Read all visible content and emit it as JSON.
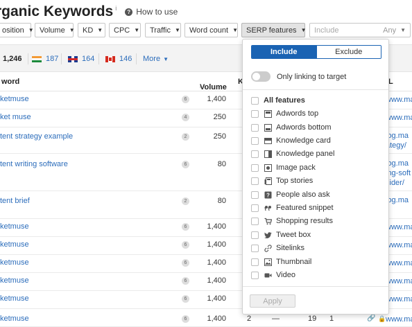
{
  "header": {
    "title": "rganic Keywords",
    "info": "i",
    "how_to": "How to use"
  },
  "filters": {
    "position": "osition",
    "volume": "Volume",
    "kd": "KD",
    "cpc": "CPC",
    "traffic": "Traffic",
    "word_count": "Word count",
    "serp_features": "SERP features",
    "include_placeholder": "Include",
    "any": "Any"
  },
  "stats": {
    "total": "1,246",
    "in": "187",
    "gb": "164",
    "ca": "146",
    "more": "More"
  },
  "table": {
    "col_keyword": "word",
    "col_volume": "Volume",
    "col_k": "K",
    "col_url": "L",
    "rows": [
      {
        "kw": "ketmuse",
        "badge": "6",
        "vol": "1,400",
        "url": "www.ma"
      },
      {
        "kw": "ket muse",
        "badge": "4",
        "vol": "250",
        "url": "www.ma"
      },
      {
        "kw": "tent strategy example",
        "badge": "2",
        "vol": "250",
        "url1": "log.ma",
        "url2": "ategy/"
      },
      {
        "kw": "tent writing software",
        "badge": "6",
        "vol": "80",
        "url1": "log.ma",
        "url2": "ing-soft",
        "url3": "sider/"
      },
      {
        "kw": "tent brief",
        "badge": "2",
        "vol": "80",
        "url1": "log.ma",
        "url2": "/"
      },
      {
        "kw": "ketmuse",
        "badge": "6",
        "vol": "1,400",
        "url": "www.ma"
      },
      {
        "kw": "ketmuse",
        "badge": "6",
        "vol": "1,400",
        "url": "www.ma"
      },
      {
        "kw": "ketmuse",
        "badge": "6",
        "vol": "1,400",
        "url": "www.ma"
      },
      {
        "kw": "ketmuse",
        "badge": "6",
        "vol": "1,400",
        "url": "www.ma"
      },
      {
        "kw": "ketmuse",
        "badge": "6",
        "vol": "1,400",
        "url": "www.ma"
      },
      {
        "kw": "ketmuse",
        "badge": "6",
        "vol": "1,400",
        "c2": "2",
        "c3": "—",
        "c4": "19",
        "c5": "1",
        "url": "www.ma"
      }
    ]
  },
  "serp_panel": {
    "include": "Include",
    "exclude": "Exclude",
    "only_linking": "Only linking to target",
    "all_features": "All features",
    "features": [
      {
        "label": "Adwords top",
        "icon": "ad-icon"
      },
      {
        "label": "Adwords bottom",
        "icon": "ad-icon"
      },
      {
        "label": "Knowledge card",
        "icon": "card-icon"
      },
      {
        "label": "Knowledge panel",
        "icon": "panel-icon"
      },
      {
        "label": "Image pack",
        "icon": "image-icon"
      },
      {
        "label": "Top stories",
        "icon": "stories-icon"
      },
      {
        "label": "People also ask",
        "icon": "question-icon"
      },
      {
        "label": "Featured snippet",
        "icon": "quote-icon"
      },
      {
        "label": "Shopping results",
        "icon": "cart-icon"
      },
      {
        "label": "Tweet box",
        "icon": "twitter-icon"
      },
      {
        "label": "Sitelinks",
        "icon": "link-icon"
      },
      {
        "label": "Thumbnail",
        "icon": "thumbnail-icon"
      },
      {
        "label": "Video",
        "icon": "video-icon"
      }
    ],
    "apply": "Apply"
  }
}
